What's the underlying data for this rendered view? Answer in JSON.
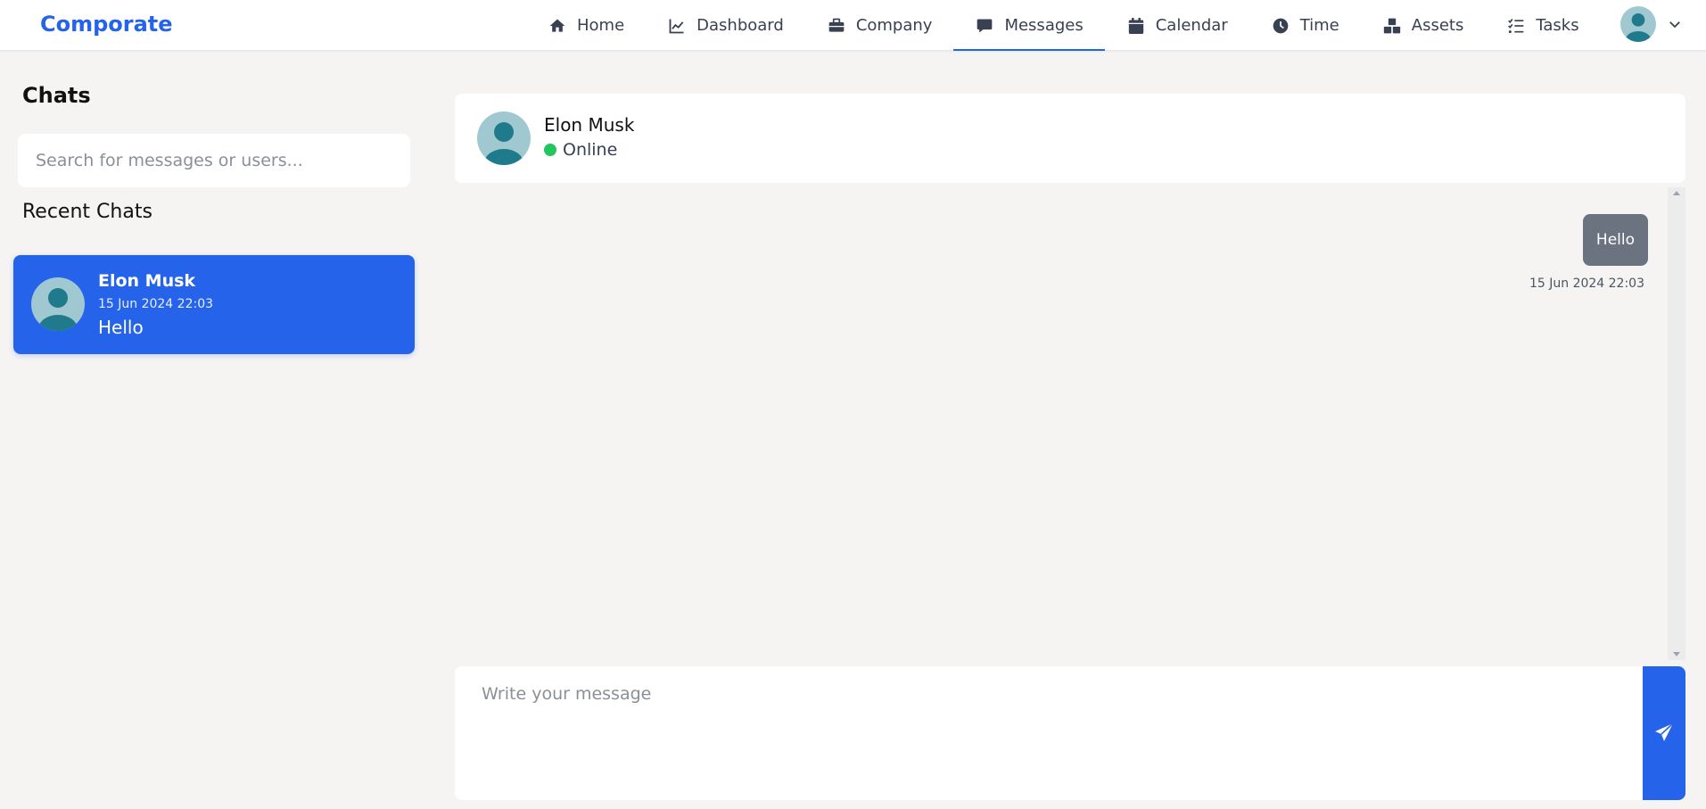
{
  "brand": "Comporate",
  "nav": {
    "items": [
      {
        "label": "Home",
        "icon": "home-icon"
      },
      {
        "label": "Dashboard",
        "icon": "chart-line-icon"
      },
      {
        "label": "Company",
        "icon": "briefcase-icon"
      },
      {
        "label": "Messages",
        "icon": "message-icon",
        "active": true
      },
      {
        "label": "Calendar",
        "icon": "calendar-icon"
      },
      {
        "label": "Time",
        "icon": "clock-icon"
      },
      {
        "label": "Assets",
        "icon": "boxes-icon"
      },
      {
        "label": "Tasks",
        "icon": "list-check-icon"
      }
    ]
  },
  "sidebar": {
    "title": "Chats",
    "search_placeholder": "Search for messages or users...",
    "recent_title": "Recent Chats",
    "chats": [
      {
        "name": "Elon Musk",
        "time": "15 Jun 2024 22:03",
        "preview": "Hello"
      }
    ]
  },
  "conversation": {
    "name": "Elon Musk",
    "status": "Online",
    "messages": [
      {
        "text": "Hello",
        "time": "15 Jun 2024 22:03"
      }
    ],
    "composer_placeholder": "Write your message"
  },
  "colors": {
    "accent": "#2563eb",
    "online": "#22c55e",
    "bubble": "#6b7280"
  }
}
